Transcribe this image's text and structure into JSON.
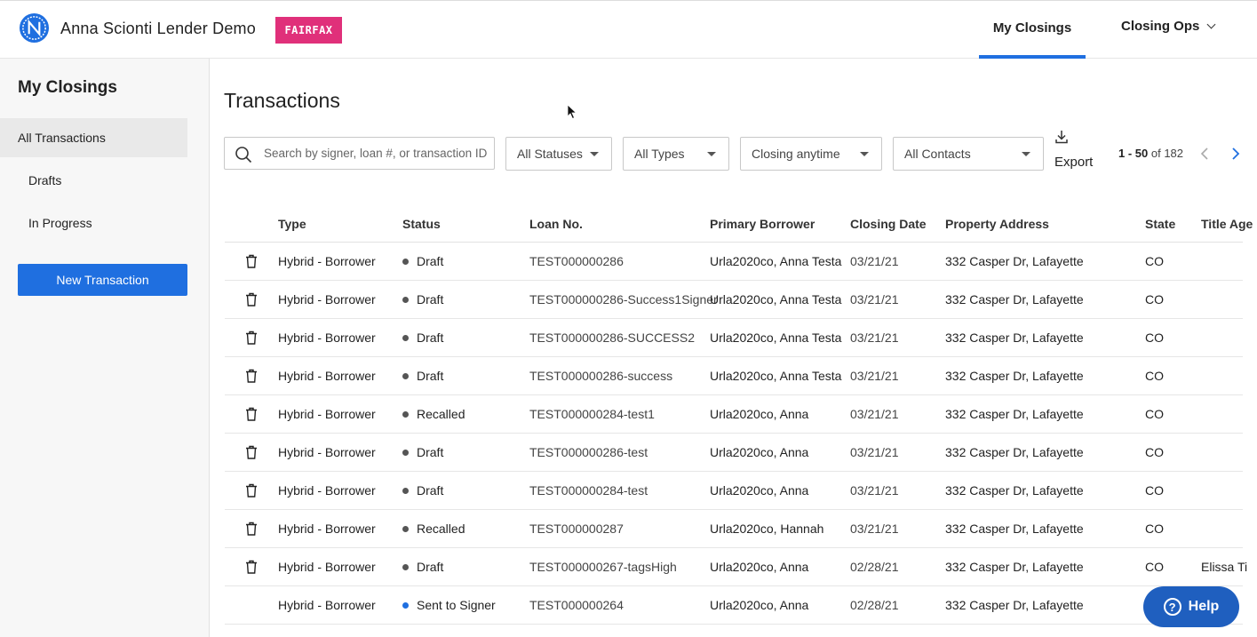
{
  "header": {
    "app_title": "Anna Scionti Lender Demo",
    "brand_badge": "FAIRFAX",
    "nav": {
      "my_closings": "My Closings",
      "closing_ops": "Closing Ops"
    }
  },
  "sidebar": {
    "title": "My Closings",
    "items": [
      {
        "label": "All Transactions"
      },
      {
        "label": "Drafts"
      },
      {
        "label": "In Progress"
      }
    ],
    "new_button": "New Transaction"
  },
  "main": {
    "title": "Transactions",
    "search": {
      "placeholder": "Search by signer, loan #, or transaction ID"
    },
    "filters": {
      "status": "All Statuses",
      "type": "All Types",
      "closing": "Closing anytime",
      "contacts": "All Contacts"
    },
    "export_label": "Export",
    "pager": {
      "range": "1 - 50",
      "of": "of 182"
    }
  },
  "table": {
    "headers": {
      "type": "Type",
      "status": "Status",
      "loan": "Loan No.",
      "borrower": "Primary Borrower",
      "date": "Closing Date",
      "address": "Property Address",
      "state": "State",
      "title_agent": "Title Age"
    },
    "rows": [
      {
        "type": "Hybrid - Borrower",
        "status": "Draft",
        "loan": "TEST000000286",
        "borrower": "Urla2020co, Anna Testa",
        "date": "03/21/21",
        "address": "332 Casper Dr, Lafayette",
        "state": "CO",
        "title_agent": ""
      },
      {
        "type": "Hybrid - Borrower",
        "status": "Draft",
        "loan": "TEST000000286-Success1Signer",
        "borrower": "Urla2020co, Anna Testa",
        "date": "03/21/21",
        "address": "332 Casper Dr, Lafayette",
        "state": "CO",
        "title_agent": ""
      },
      {
        "type": "Hybrid - Borrower",
        "status": "Draft",
        "loan": "TEST000000286-SUCCESS2",
        "borrower": "Urla2020co, Anna Testa",
        "date": "03/21/21",
        "address": "332 Casper Dr, Lafayette",
        "state": "CO",
        "title_agent": ""
      },
      {
        "type": "Hybrid - Borrower",
        "status": "Draft",
        "loan": "TEST000000286-success",
        "borrower": "Urla2020co, Anna Testa",
        "date": "03/21/21",
        "address": "332 Casper Dr, Lafayette",
        "state": "CO",
        "title_agent": ""
      },
      {
        "type": "Hybrid - Borrower",
        "status": "Recalled",
        "loan": "TEST000000284-test1",
        "borrower": "Urla2020co, Anna",
        "date": "03/21/21",
        "address": "332 Casper Dr, Lafayette",
        "state": "CO",
        "title_agent": ""
      },
      {
        "type": "Hybrid - Borrower",
        "status": "Draft",
        "loan": "TEST000000286-test",
        "borrower": "Urla2020co, Anna",
        "date": "03/21/21",
        "address": "332 Casper Dr, Lafayette",
        "state": "CO",
        "title_agent": ""
      },
      {
        "type": "Hybrid - Borrower",
        "status": "Draft",
        "loan": "TEST000000284-test",
        "borrower": "Urla2020co, Anna",
        "date": "03/21/21",
        "address": "332 Casper Dr, Lafayette",
        "state": "CO",
        "title_agent": ""
      },
      {
        "type": "Hybrid - Borrower",
        "status": "Recalled",
        "loan": "TEST000000287",
        "borrower": "Urla2020co, Hannah",
        "date": "03/21/21",
        "address": "332 Casper Dr, Lafayette",
        "state": "CO",
        "title_agent": ""
      },
      {
        "type": "Hybrid - Borrower",
        "status": "Draft",
        "loan": "TEST000000267-tagsHigh",
        "borrower": "Urla2020co, Anna",
        "date": "02/28/21",
        "address": "332 Casper Dr, Lafayette",
        "state": "CO",
        "title_agent": "Elissa Ti"
      },
      {
        "type": "Hybrid - Borrower",
        "status": "Sent to Signer",
        "loan": "TEST000000264",
        "borrower": "Urla2020co, Anna",
        "date": "02/28/21",
        "address": "332 Casper Dr, Lafayette",
        "state": "",
        "title_agent": ""
      }
    ]
  },
  "help_label": "Help",
  "colors": {
    "accent": "#1f6fe0",
    "badge": "#e0307a",
    "help": "#1f5fbf"
  }
}
